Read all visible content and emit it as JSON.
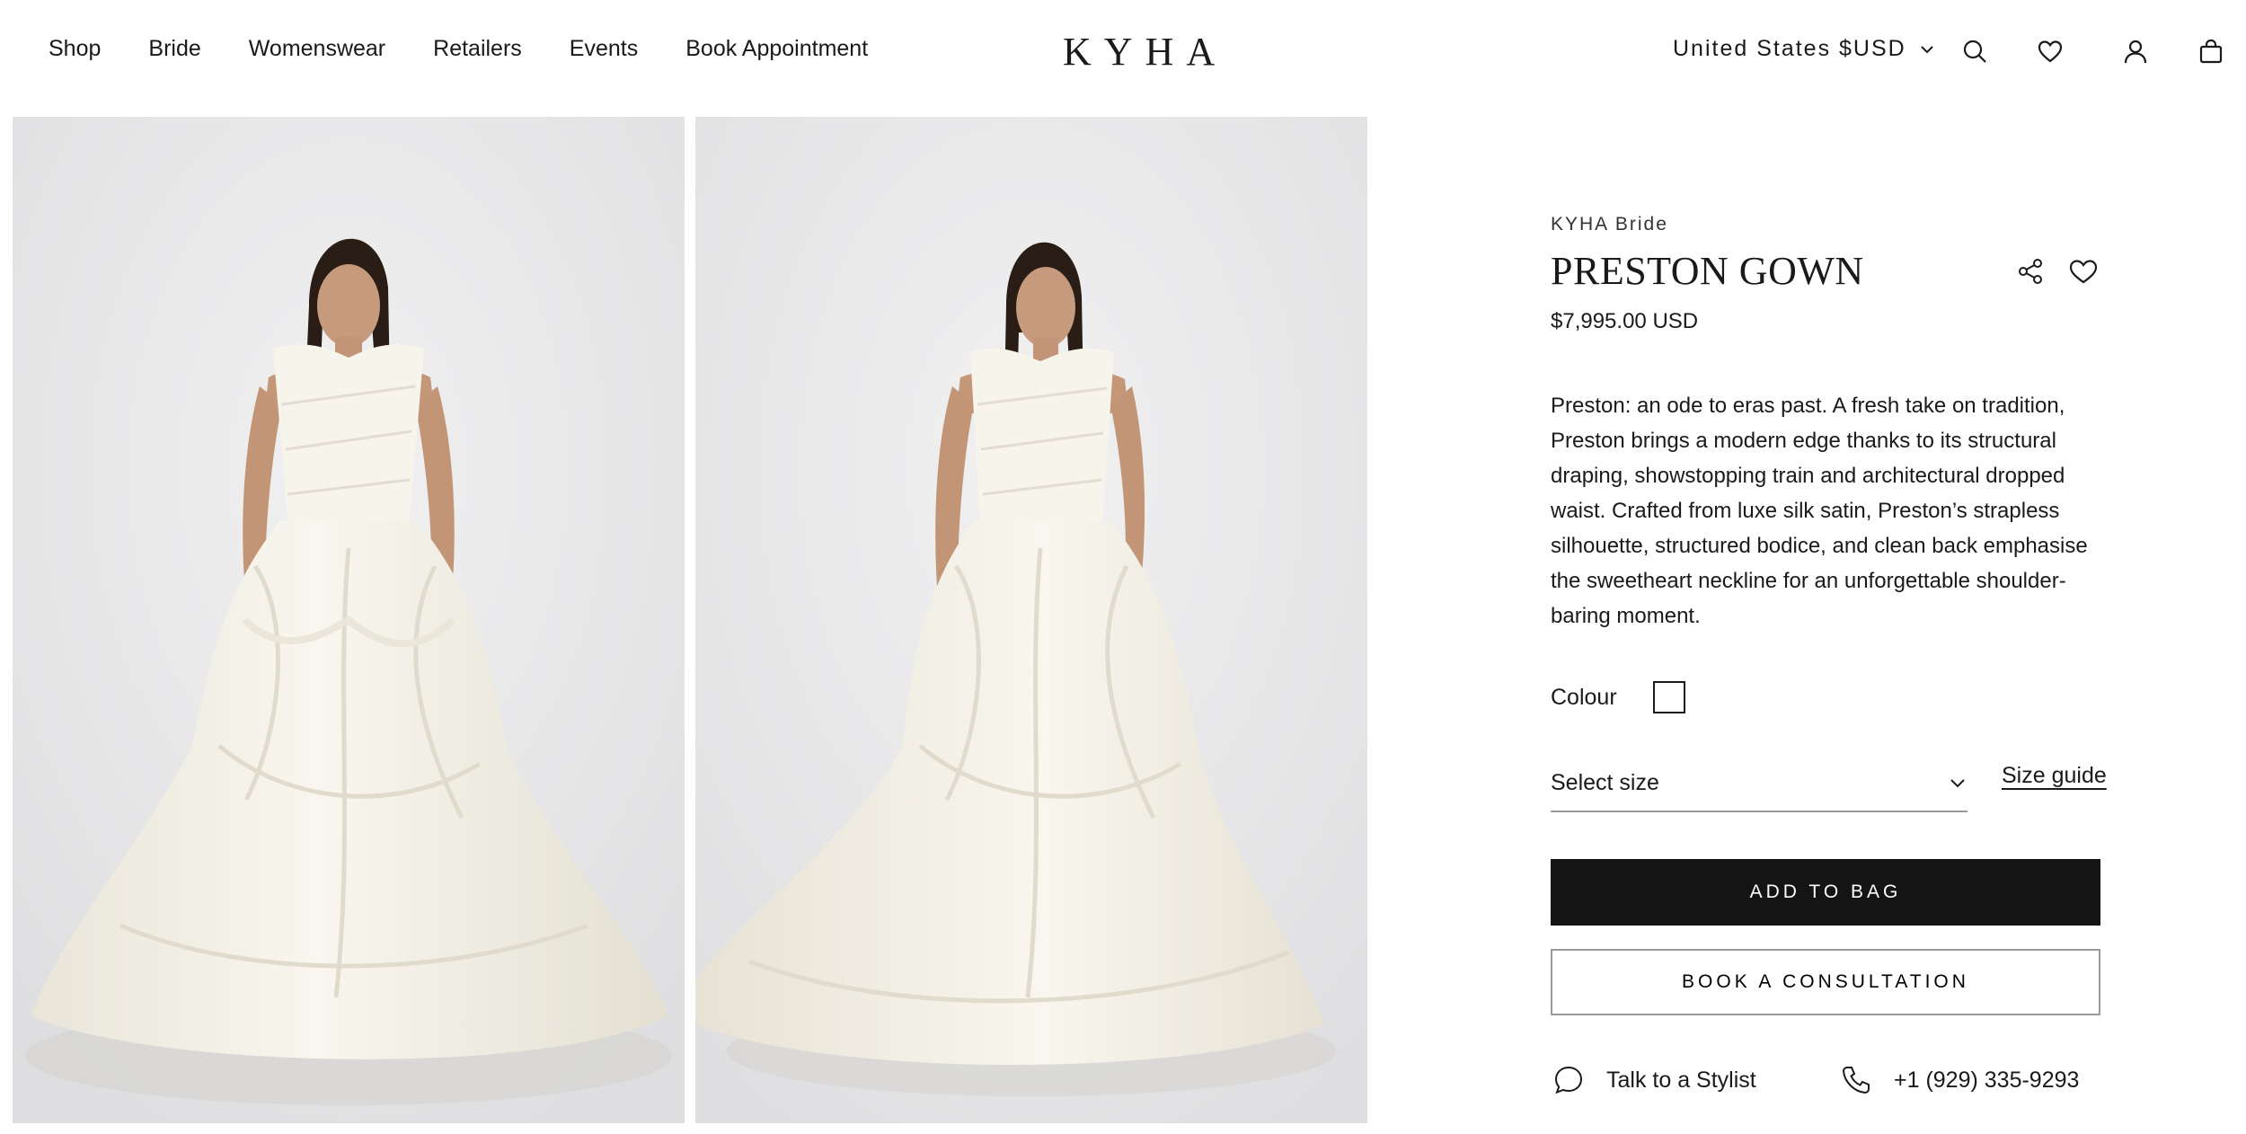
{
  "header": {
    "nav": [
      "Shop",
      "Bride",
      "Womenswear",
      "Retailers",
      "Events",
      "Book Appointment"
    ],
    "logo": "KYHA",
    "currency": "United States $USD",
    "icons": [
      "search-icon",
      "wishlist-icon",
      "account-icon",
      "bag-icon"
    ]
  },
  "gallery": {
    "images": [
      "front-view",
      "three-quarter-view"
    ],
    "backdrop_color": "#e7e7e8",
    "gown_color": "#f4f1e8"
  },
  "product": {
    "brand": "KYHA Bride",
    "title": "PRESTON GOWN",
    "price": "$7,995.00 USD",
    "description": "Preston: an ode to eras past. A fresh take on tradition, Preston brings a modern edge thanks to its structural draping, showstopping train and architectural dropped waist. Crafted from luxe silk satin, Preston’s strapless silhouette, structured bodice, and clean back emphasise the sweetheart neckline for an unforgettable shoulder-baring moment.",
    "colour_label": "Colour",
    "colour_swatch": "#ffffff",
    "size_placeholder": "Select size",
    "size_guide": "Size guide",
    "add_to_bag": "ADD TO BAG",
    "book_consultation": "BOOK A CONSULTATION",
    "stylist": "Talk to a Stylist",
    "phone": "+1 (929) 335-9293"
  }
}
